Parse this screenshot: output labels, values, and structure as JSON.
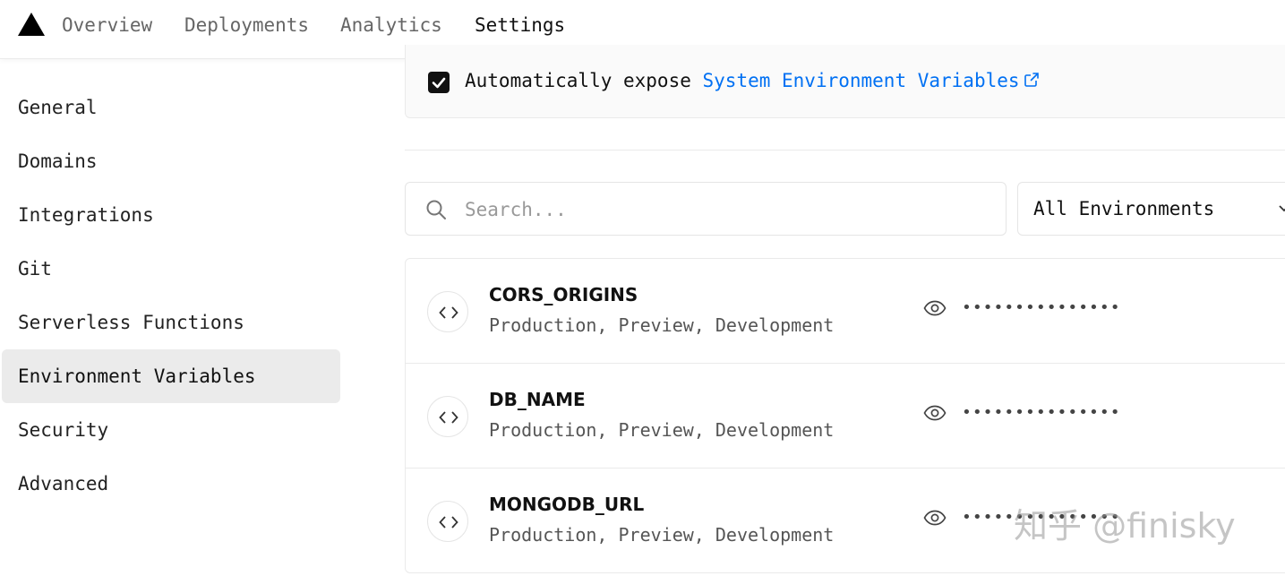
{
  "nav": {
    "tabs": [
      {
        "label": "Overview"
      },
      {
        "label": "Deployments"
      },
      {
        "label": "Analytics"
      },
      {
        "label": "Settings",
        "active": true
      }
    ]
  },
  "sidebar": {
    "items": [
      {
        "label": "General"
      },
      {
        "label": "Domains"
      },
      {
        "label": "Integrations"
      },
      {
        "label": "Git"
      },
      {
        "label": "Serverless Functions"
      },
      {
        "label": "Environment Variables",
        "active": true
      },
      {
        "label": "Security"
      },
      {
        "label": "Advanced"
      }
    ]
  },
  "expose": {
    "checked": true,
    "prefix": "Automatically expose ",
    "link_text": "System Environment Variables",
    "link_icon": "external-link-icon"
  },
  "search": {
    "placeholder": "Search...",
    "value": "",
    "icon": "search-icon"
  },
  "filter": {
    "selected": "All Environments",
    "icon": "chevron-down-icon"
  },
  "variables": [
    {
      "name": "CORS_ORIGINS",
      "environments": "Production, Preview, Development",
      "masked_value": "•••••••••••••••"
    },
    {
      "name": "DB_NAME",
      "environments": "Production, Preview, Development",
      "masked_value": "•••••••••••••••"
    },
    {
      "name": "MONGODB_URL",
      "environments": "Production, Preview, Development",
      "masked_value": "•••••••••••••••"
    }
  ],
  "watermark": "知乎 @finisky",
  "colors": {
    "accent_link": "#0070f3",
    "active_sidebar_bg": "#ebebeb",
    "text_primary": "#111111",
    "text_secondary": "#555555"
  }
}
